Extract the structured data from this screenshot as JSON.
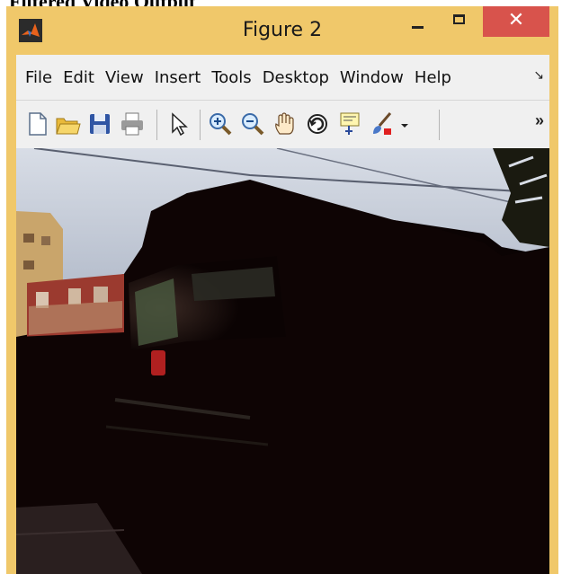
{
  "caption": "Filtered Video Output",
  "window": {
    "title": "Figure 2",
    "controls": {
      "minimize": "minimize",
      "maximize": "maximize",
      "close": "✕"
    }
  },
  "menu": [
    "File",
    "Edit",
    "View",
    "Insert",
    "Tools",
    "Desktop",
    "Window",
    "Help"
  ],
  "toolbar": {
    "icons": [
      "new-figure-icon",
      "open-file-icon",
      "save-icon",
      "print-icon",
      "edit-plot-arrow-icon",
      "zoom-in-icon",
      "zoom-out-icon",
      "pan-hand-icon",
      "rotate-3d-icon",
      "data-cursor-icon",
      "brush-icon"
    ],
    "overflow": "»"
  },
  "image": {
    "description_colors": {
      "sky": "#c9d1de",
      "dark": "#0b0303",
      "building": "#c9a56b",
      "red_building": "#9b3a2f"
    }
  }
}
